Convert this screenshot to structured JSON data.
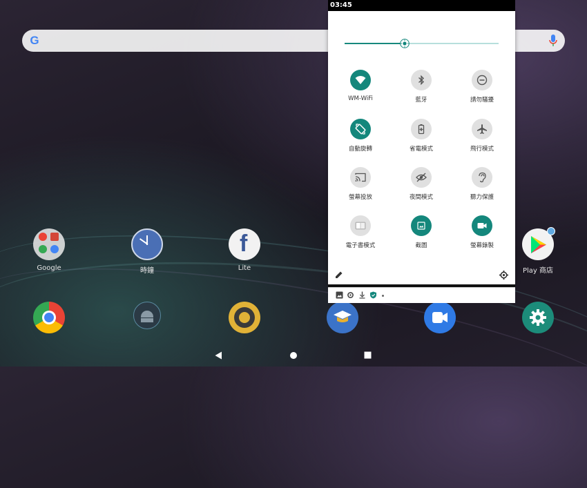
{
  "status_bar": {
    "time": "03:45"
  },
  "search_bar": {
    "logo": "G"
  },
  "desktop": {
    "row1": [
      {
        "label": "Google",
        "icon": "google-folder-icon"
      },
      {
        "label": "時鐘",
        "icon": "clock-icon"
      },
      {
        "label": "Lite",
        "icon": "facebook-lite-icon"
      },
      {
        "label": "Play 商店",
        "icon": "play-store-icon"
      }
    ],
    "dock": [
      {
        "icon": "chrome-icon"
      },
      {
        "icon": "android-icon"
      },
      {
        "icon": "camera-aperture-icon"
      },
      {
        "icon": "education-icon"
      },
      {
        "icon": "video-call-icon"
      },
      {
        "icon": "settings-icon"
      }
    ]
  },
  "quick_settings": {
    "brightness_level": 0.39,
    "tiles": [
      {
        "label": "WM-WiFi",
        "active": true,
        "icon": "wifi-icon"
      },
      {
        "label": "藍牙",
        "active": false,
        "icon": "bluetooth-icon"
      },
      {
        "label": "請勿騷擾",
        "active": false,
        "icon": "do-not-disturb-icon"
      },
      {
        "label": "自動旋轉",
        "active": true,
        "icon": "auto-rotate-icon"
      },
      {
        "label": "省電模式",
        "active": false,
        "icon": "battery-saver-icon"
      },
      {
        "label": "飛行模式",
        "active": false,
        "icon": "airplane-icon"
      },
      {
        "label": "螢幕投放",
        "active": false,
        "icon": "cast-icon"
      },
      {
        "label": "夜間模式",
        "active": false,
        "icon": "night-mode-icon"
      },
      {
        "label": "聽力保護",
        "active": false,
        "icon": "hearing-icon"
      },
      {
        "label": "電子書模式",
        "active": false,
        "icon": "ebook-icon"
      },
      {
        "label": "截圖",
        "active": true,
        "icon": "screenshot-icon"
      },
      {
        "label": "螢幕錄製",
        "active": true,
        "icon": "screen-record-icon"
      }
    ]
  },
  "colors": {
    "accent": "#14877c",
    "tile_inactive": "#e0e0e0"
  }
}
